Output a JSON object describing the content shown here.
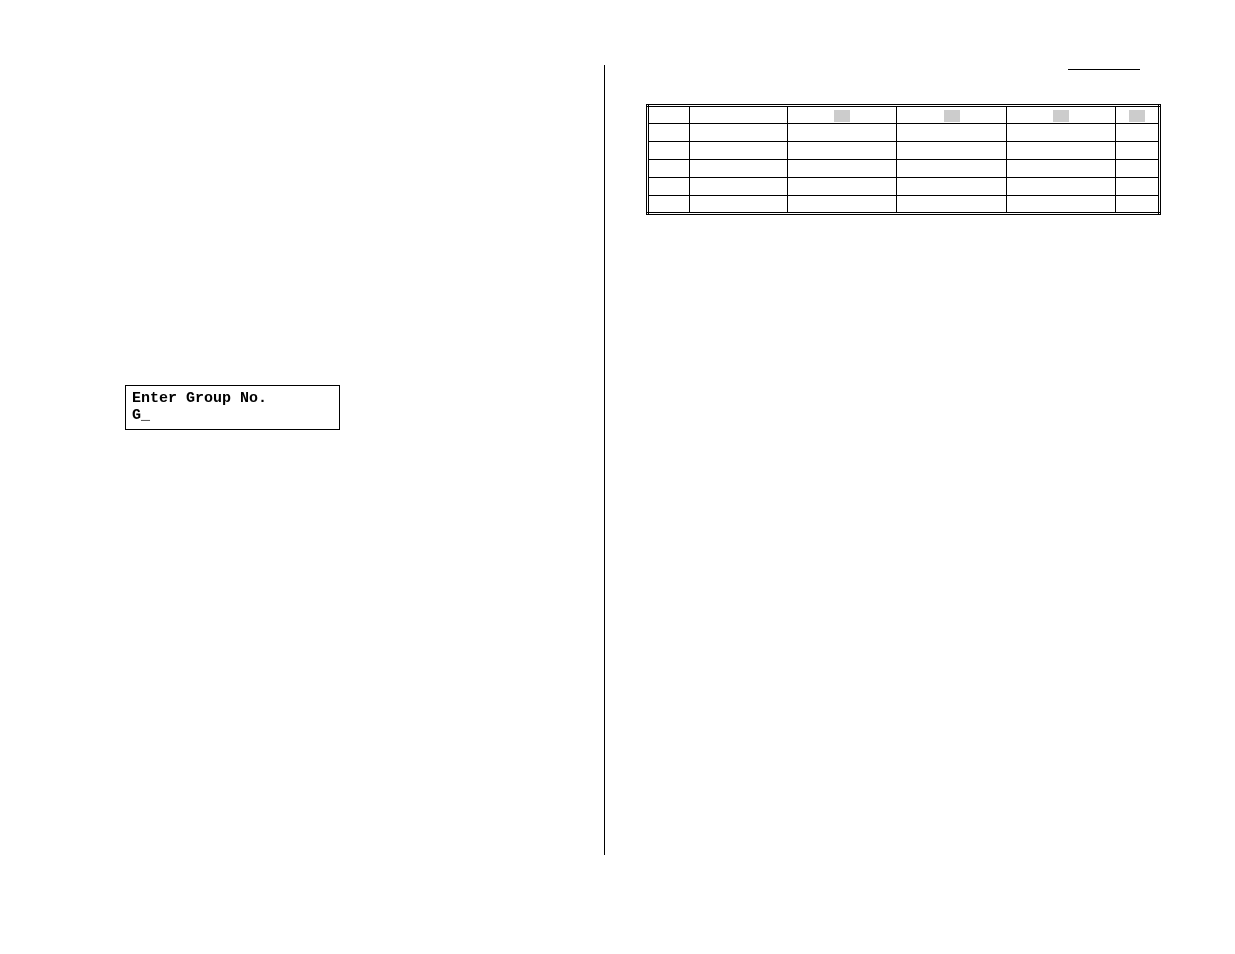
{
  "prompt": {
    "line1": "Enter Group No.",
    "line2": "G_"
  },
  "table": {
    "headers": [
      "",
      "",
      "",
      "",
      "",
      ""
    ],
    "rows": [
      [
        "",
        "",
        "",
        "",
        "",
        ""
      ],
      [
        "",
        "",
        "",
        "",
        "",
        ""
      ],
      [
        "",
        "",
        "",
        "",
        "",
        ""
      ],
      [
        "",
        "",
        "",
        "",
        "",
        ""
      ],
      [
        "",
        "",
        "",
        "",
        "",
        ""
      ]
    ]
  }
}
